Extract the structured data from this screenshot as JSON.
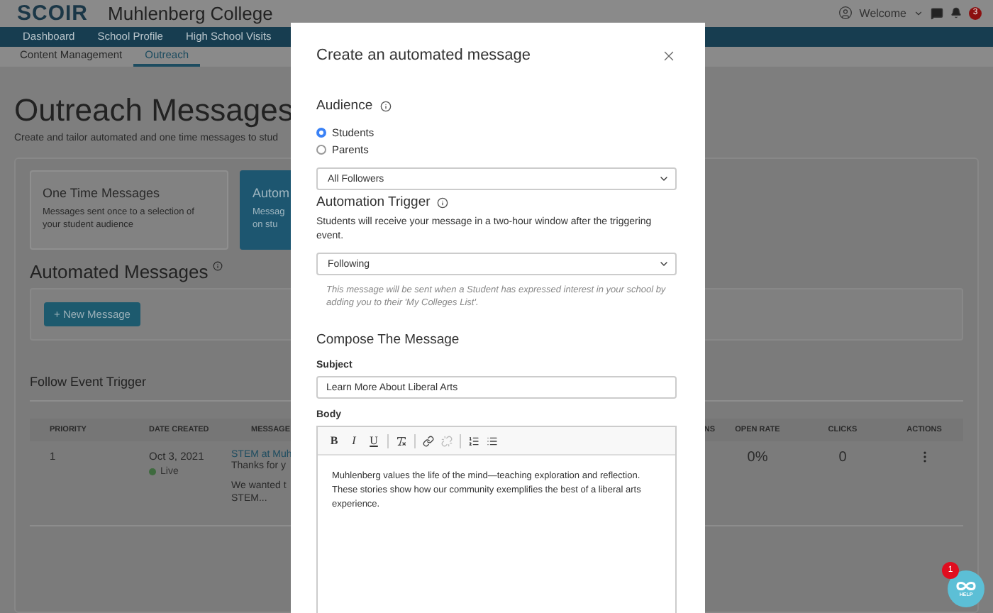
{
  "header": {
    "logo": "SCOIR",
    "college": "Muhlenberg College",
    "user_menu": "Welcome",
    "notification_count": "3"
  },
  "nav": [
    {
      "label": "Dashboard",
      "selected": false
    },
    {
      "label": "School Profile",
      "selected": false
    },
    {
      "label": "High School Visits",
      "selected": false
    }
  ],
  "subnav": [
    {
      "label": "Content Management",
      "selected": false
    },
    {
      "label": "Outreach",
      "selected": true
    }
  ],
  "page": {
    "title": "Outreach Messages",
    "subtitle": "Create and tailor automated and one time messages to stud"
  },
  "message_types": [
    {
      "title": "One Time Messages",
      "description_lines": [
        "Messages sent once to a selection of",
        "your student audience"
      ],
      "selected": false
    },
    {
      "title": "Autom",
      "description_lines": [
        "Messag",
        "on stu"
      ],
      "selected": true
    }
  ],
  "automated": {
    "heading": "Automated Messages",
    "new_button": "+ New Message"
  },
  "section_title": "Follow Event Trigger",
  "table": {
    "columns": [
      "PRIORITY",
      "DATE CREATED",
      "MESSAGE",
      "NS",
      "OPEN RATE",
      "CLICKS",
      "ACTIONS"
    ],
    "rows": [
      {
        "priority": "1",
        "date": "Oct 3, 2021",
        "status": "Live",
        "message_title": "STEM at Muh",
        "message_lines": [
          "Thanks for y",
          "We wanted t",
          "STEM..."
        ],
        "open_rate": "0%",
        "clicks": "0"
      }
    ]
  },
  "modal": {
    "title": "Create an automated message",
    "audience": {
      "label": "Audience",
      "options": [
        {
          "label": "Students",
          "selected": true
        },
        {
          "label": "Parents",
          "selected": false
        }
      ],
      "select": "All Followers"
    },
    "trigger": {
      "label": "Automation Trigger",
      "description": "Students will receive your message in a two-hour window after the triggering event.",
      "select": "Following",
      "help": "This message will be sent when a Student has expressed interest in your school by adding you to their 'My Colleges List'."
    },
    "compose": {
      "heading": "Compose The Message",
      "subject_label": "Subject",
      "subject_value": "Learn More About Liberal Arts",
      "body_label": "Body",
      "format_buttons": [
        {
          "label": "B",
          "kind": "bold"
        },
        {
          "label": "I",
          "kind": "italic"
        },
        {
          "label": "U",
          "kind": "underline"
        }
      ],
      "body": "Muhlenberg values the life of the mind—teaching exploration and reflection. These stories show how our community exemplifies the best of a liberal arts experience."
    }
  },
  "help_widget": {
    "label": "HELP",
    "badge": "1"
  }
}
